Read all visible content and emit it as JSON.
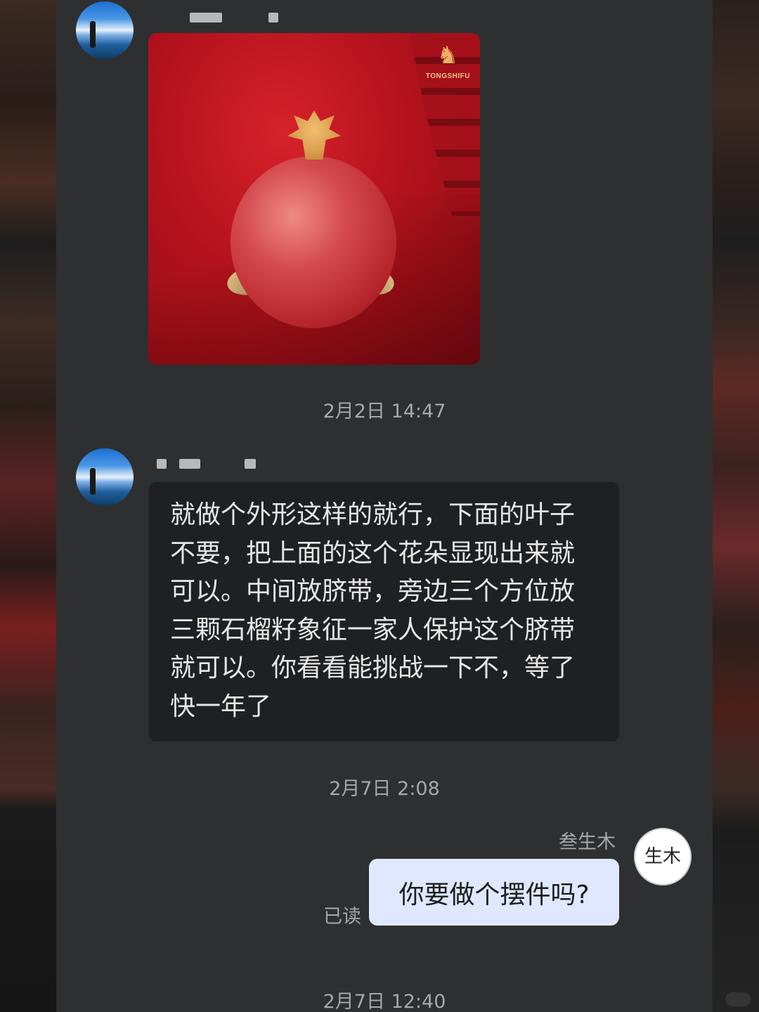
{
  "conversation": {
    "messages": [
      {
        "type": "image",
        "sender": "other",
        "brand_text": "TONGSHIFU"
      },
      {
        "type": "timestamp",
        "text": "2月2日 14:47"
      },
      {
        "type": "text",
        "sender": "other",
        "text": "就做个外形这样的就行，下面的叶子不要，把上面的这个花朵显现出来就可以。中间放脐带，旁边三个方位放三颗石榴籽象征一家人保护这个脐带就可以。你看看能挑战一下不，等了快一年了"
      },
      {
        "type": "timestamp",
        "text": "2月7日 2:08"
      },
      {
        "type": "text",
        "sender": "me",
        "sender_name": "叁生木",
        "read_status": "已读",
        "text": "你要做个摆件吗?"
      },
      {
        "type": "timestamp",
        "text": "2月7日 12:40"
      }
    ],
    "my_avatar_text": "生木"
  },
  "colors": {
    "panel": "#2e2f31",
    "incoming_bubble": "#1f2022",
    "outgoing_bubble": "#dfe8ff",
    "meta_text": "#a7a7a9"
  },
  "icons": [
    "avatar-other",
    "avatar-me"
  ]
}
